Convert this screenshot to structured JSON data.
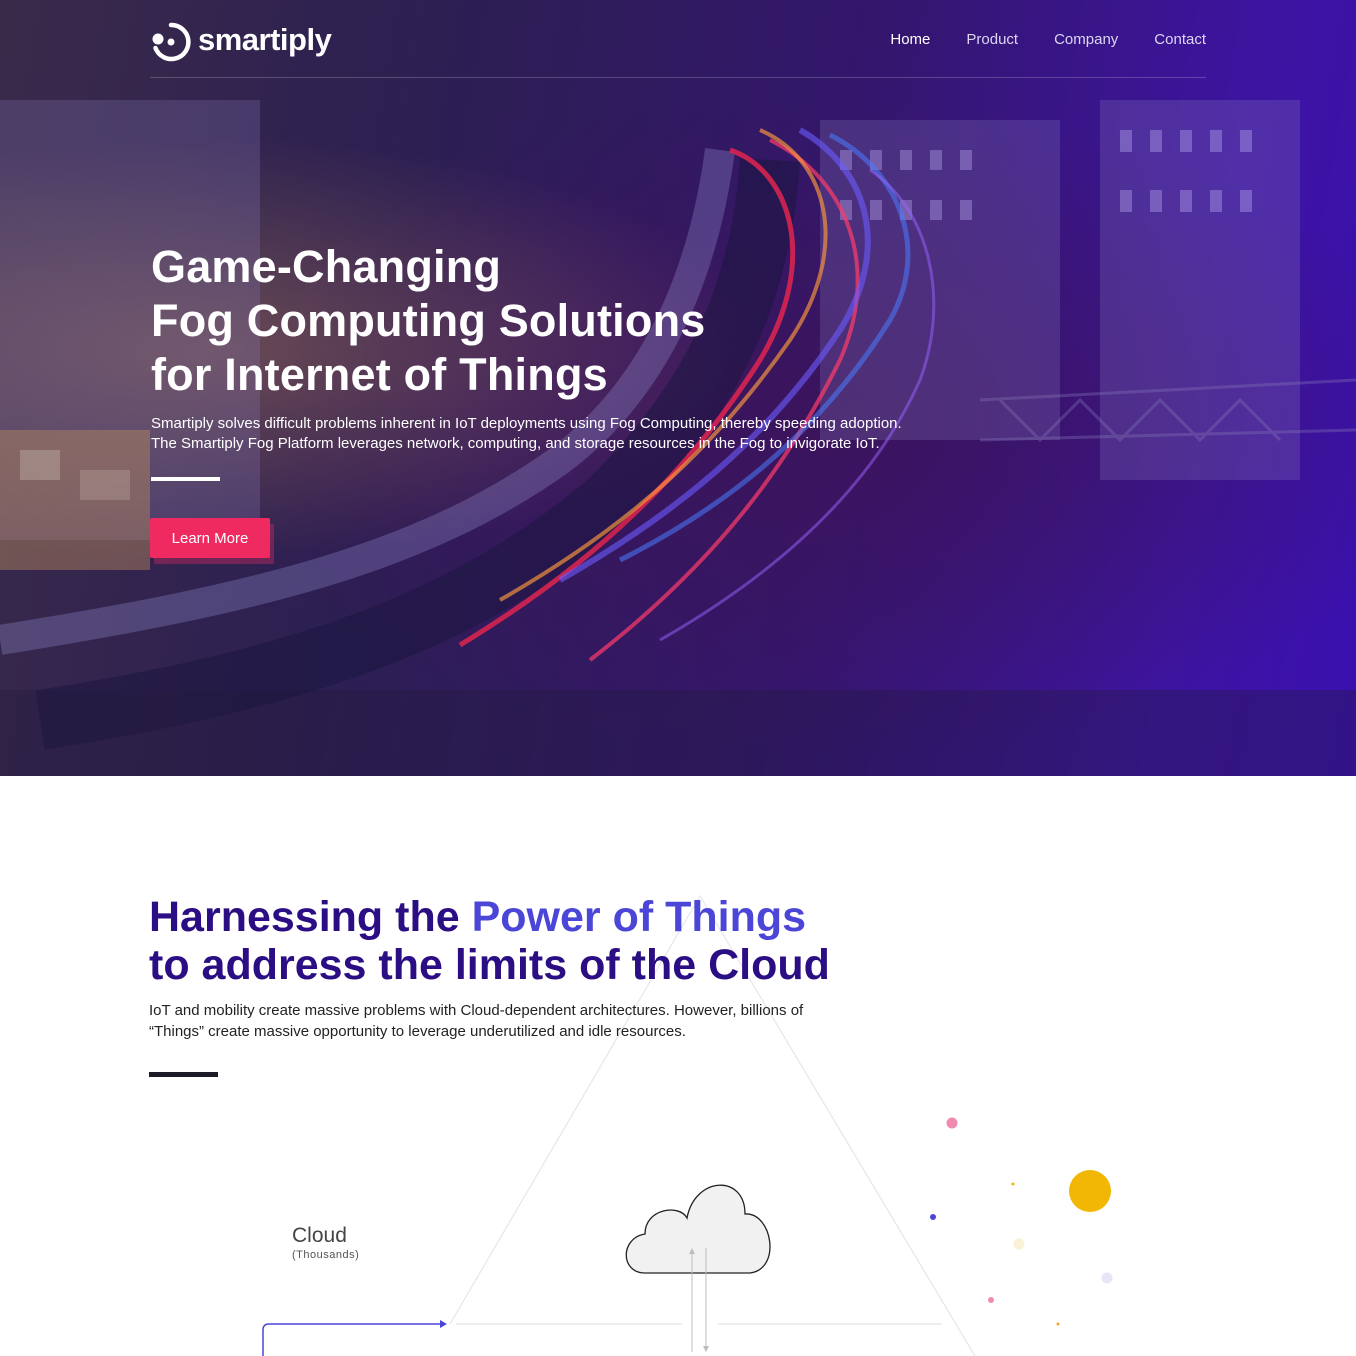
{
  "brand": {
    "name": "smartiply"
  },
  "nav": {
    "items": [
      {
        "label": "Home",
        "active": true
      },
      {
        "label": "Product",
        "active": false
      },
      {
        "label": "Company",
        "active": false
      },
      {
        "label": "Contact",
        "active": false
      }
    ]
  },
  "hero": {
    "title_lines": [
      "Game-Changing",
      "Fog Computing Solutions",
      "for Internet of Things"
    ],
    "subtitle_lines": [
      "Smartiply solves difficult problems inherent in IoT deployments using Fog Computing, thereby speeding adoption.",
      "The Smartiply Fog Platform leverages network, computing, and storage resources in the Fog to invigorate IoT."
    ],
    "cta_label": "Learn More"
  },
  "section": {
    "title_part1": "Harnessing the ",
    "title_accent": "Power of Things",
    "title_line2": "to address the limits of the Cloud",
    "body_lines": [
      "IoT and mobility create massive problems with Cloud-dependent architectures. However, billions of",
      "“Things” create massive opportunity to leverage underutilized and idle resources."
    ]
  },
  "diagram": {
    "cloud_label": "Cloud",
    "cloud_sub": "(Thousands)"
  },
  "colors": {
    "primary_dark": "#2b0d84",
    "accent": "#4b46d8",
    "cta": "#ee2a61",
    "dot_yellow": "#f2b705",
    "dot_pink": "#f08bb0",
    "dot_blue": "#4b46d8"
  }
}
